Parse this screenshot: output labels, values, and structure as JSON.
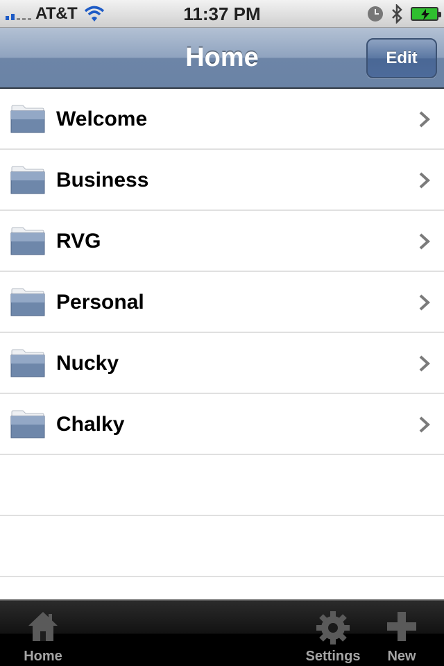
{
  "status_bar": {
    "carrier": "AT&T",
    "time": "11:37 PM",
    "icons": [
      "signal-icon",
      "wifi-icon",
      "alarm-clock-icon",
      "bluetooth-icon",
      "battery-charging-icon"
    ]
  },
  "nav": {
    "title": "Home",
    "edit_label": "Edit"
  },
  "list": {
    "items": [
      {
        "label": "Welcome",
        "icon": "folder-icon"
      },
      {
        "label": "Business",
        "icon": "folder-icon"
      },
      {
        "label": "RVG",
        "icon": "folder-icon"
      },
      {
        "label": "Personal",
        "icon": "folder-icon"
      },
      {
        "label": "Nucky",
        "icon": "folder-icon"
      },
      {
        "label": "Chalky",
        "icon": "folder-icon"
      }
    ]
  },
  "tab_bar": {
    "home_label": "Home",
    "settings_label": "Settings",
    "new_label": "New"
  },
  "colors": {
    "nav_bar": "#6d85a7",
    "edit_button": "#4d6b9a",
    "signal": "#1e5bc6",
    "battery": "#2fbf2f"
  }
}
